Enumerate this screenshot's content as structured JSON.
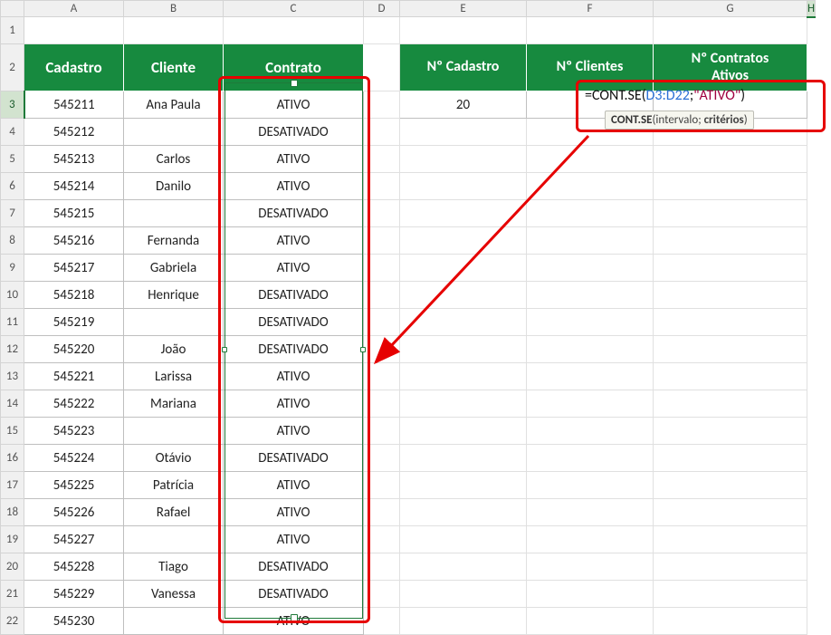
{
  "columns": [
    "A",
    "B",
    "C",
    "D",
    "E",
    "F",
    "G",
    "H"
  ],
  "table1": {
    "headers": {
      "cadastro": "Cadastro",
      "cliente": "Cliente",
      "contrato": "Contrato"
    },
    "rows": [
      {
        "cadastro": "545211",
        "cliente": "Ana Paula",
        "contrato": "ATIVO"
      },
      {
        "cadastro": "545212",
        "cliente": "",
        "contrato": "DESATIVADO"
      },
      {
        "cadastro": "545213",
        "cliente": "Carlos",
        "contrato": "ATIVO"
      },
      {
        "cadastro": "545214",
        "cliente": "Danilo",
        "contrato": "ATIVO"
      },
      {
        "cadastro": "545215",
        "cliente": "",
        "contrato": "DESATIVADO"
      },
      {
        "cadastro": "545216",
        "cliente": "Fernanda",
        "contrato": "ATIVO"
      },
      {
        "cadastro": "545217",
        "cliente": "Gabriela",
        "contrato": "ATIVO"
      },
      {
        "cadastro": "545218",
        "cliente": "Henrique",
        "contrato": "DESATIVADO"
      },
      {
        "cadastro": "545219",
        "cliente": "",
        "contrato": "DESATIVADO"
      },
      {
        "cadastro": "545220",
        "cliente": "João",
        "contrato": "DESATIVADO"
      },
      {
        "cadastro": "545221",
        "cliente": "Larissa",
        "contrato": "ATIVO"
      },
      {
        "cadastro": "545222",
        "cliente": "Mariana",
        "contrato": "ATIVO"
      },
      {
        "cadastro": "545223",
        "cliente": "",
        "contrato": "ATIVO"
      },
      {
        "cadastro": "545224",
        "cliente": "Otávio",
        "contrato": "DESATIVADO"
      },
      {
        "cadastro": "545225",
        "cliente": "Patrícia",
        "contrato": "ATIVO"
      },
      {
        "cadastro": "545226",
        "cliente": "Rafael",
        "contrato": "ATIVO"
      },
      {
        "cadastro": "545227",
        "cliente": "",
        "contrato": "ATIVO"
      },
      {
        "cadastro": "545228",
        "cliente": "Tiago",
        "contrato": "DESATIVADO"
      },
      {
        "cadastro": "545229",
        "cliente": "Vanessa",
        "contrato": "DESATIVADO"
      },
      {
        "cadastro": "545230",
        "cliente": "",
        "contrato": "ATIVO"
      }
    ]
  },
  "table2": {
    "headers": {
      "ncadastro": "Nº Cadastro",
      "nclientes": "Nº Clientes",
      "ncontratos_line1": "Nº Contratos",
      "ncontratos_line2": "Ativos"
    },
    "values": {
      "ncadastro": "20"
    }
  },
  "formula": {
    "prefix": "=CONT.SE(",
    "range": "D3:D22",
    "sep": ";",
    "criteria": "\"ATIVO\"",
    "suffix": ")"
  },
  "tooltip": {
    "fname": "CONT.SE",
    "open": "(",
    "arg1": "intervalo",
    "sep": "; ",
    "arg2": "critérios",
    "close": ")"
  }
}
